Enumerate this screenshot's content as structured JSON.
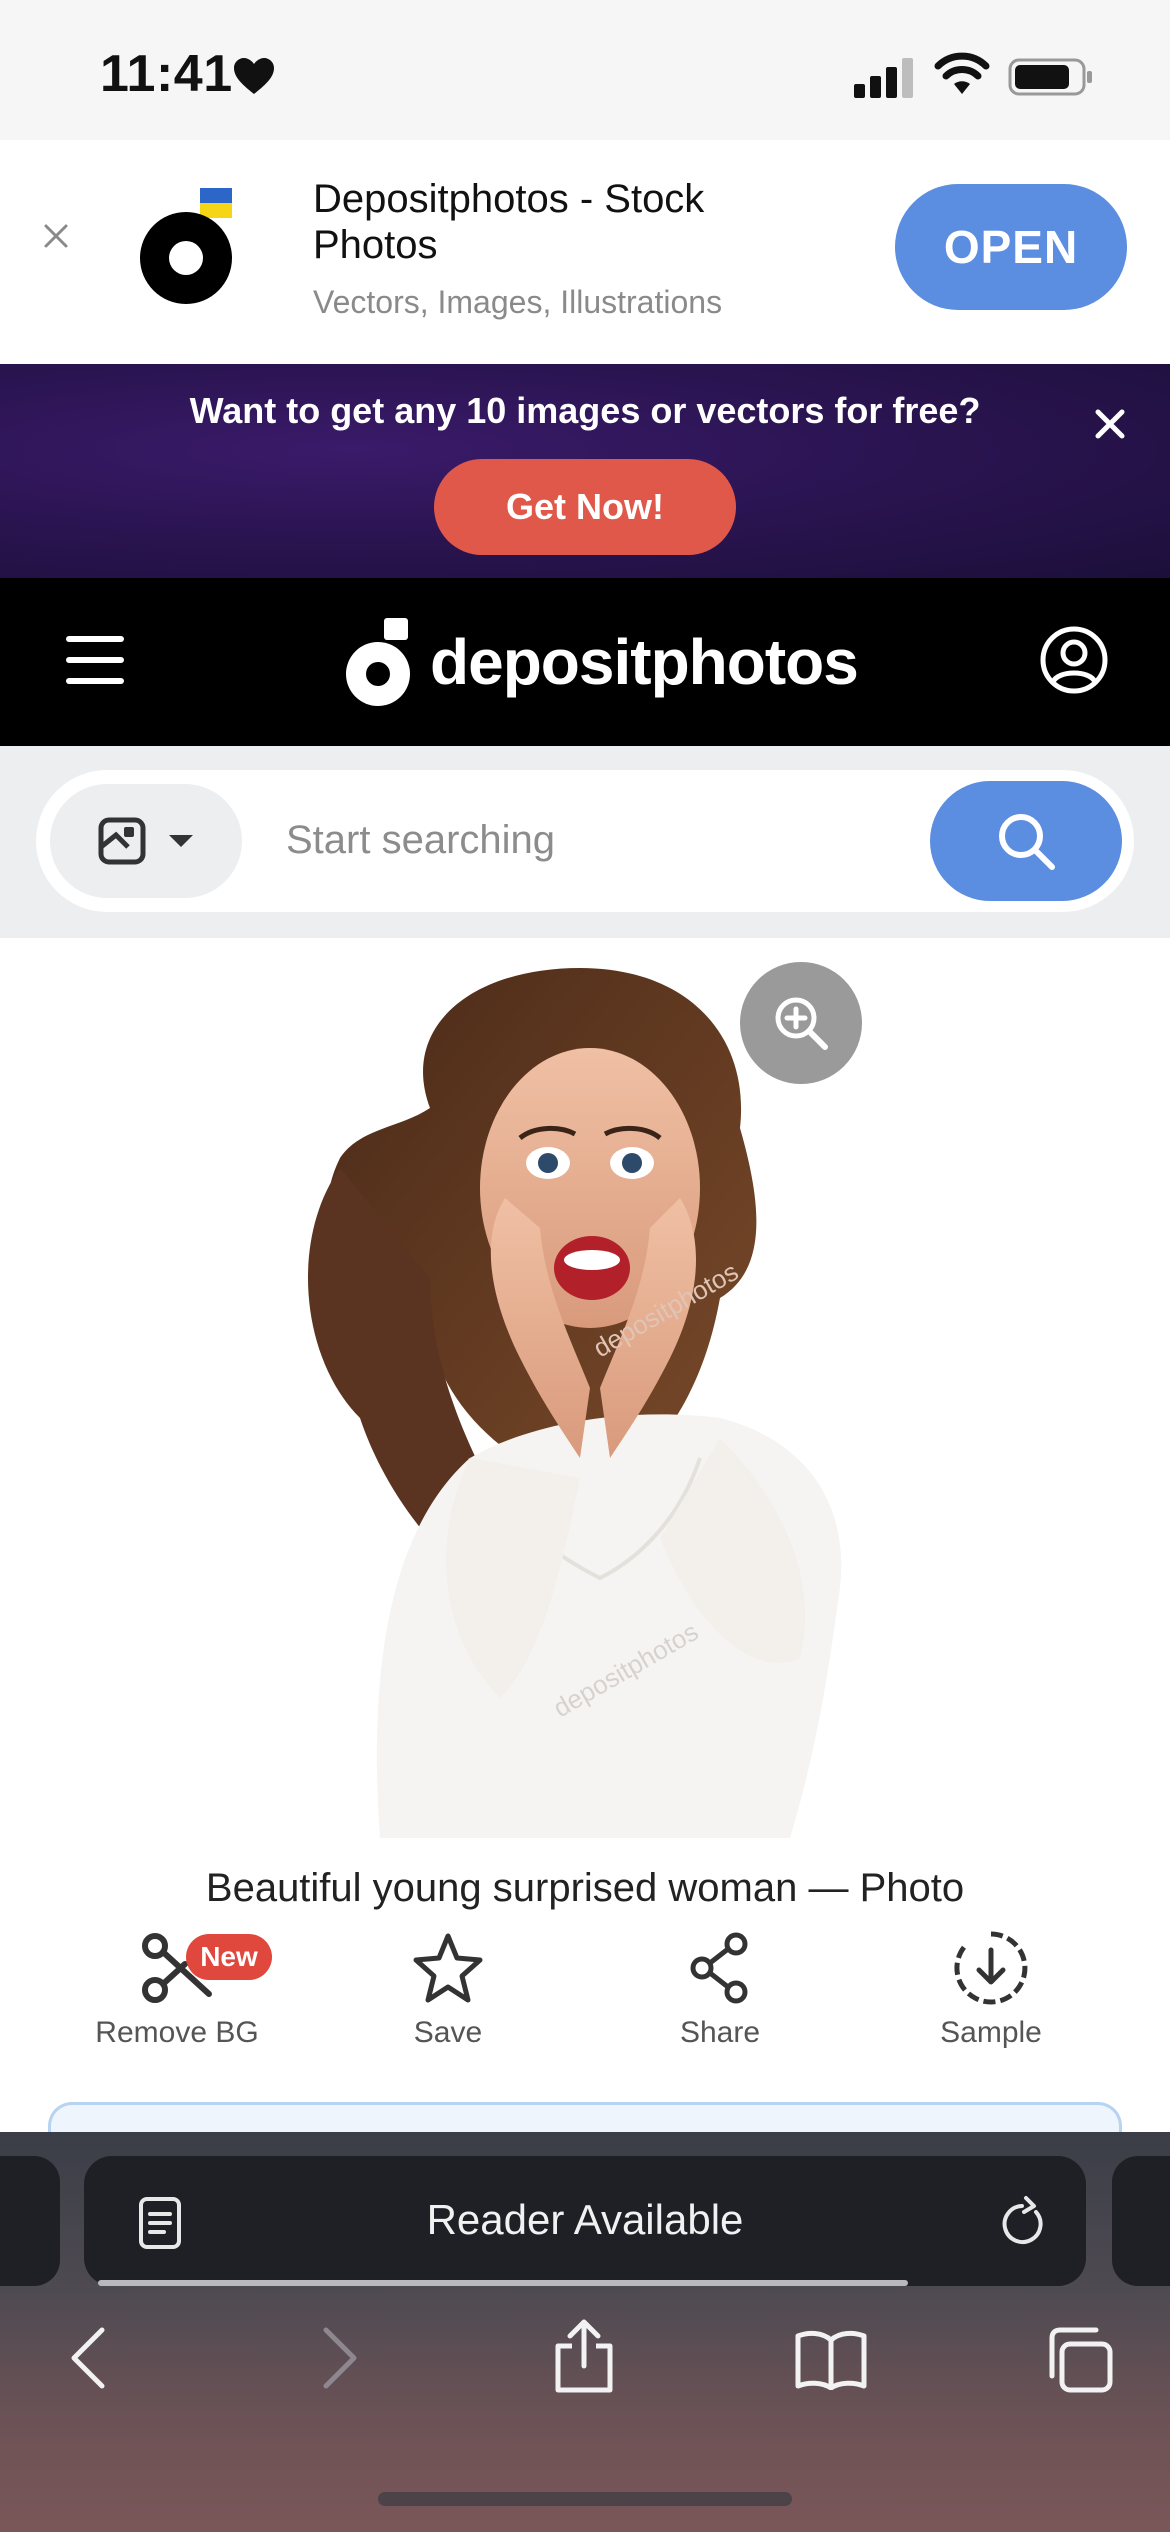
{
  "status_bar": {
    "time": "11:41"
  },
  "app_banner": {
    "name": "Depositphotos - Stock Photos",
    "subtitle": "Vectors, Images, Illustrations",
    "open_label": "OPEN"
  },
  "promo": {
    "text": "Want to get any 10 images or vectors for free?",
    "button_label": "Get Now!"
  },
  "nav": {
    "logo_text": "depositphotos"
  },
  "search": {
    "placeholder": "Start searching",
    "value": ""
  },
  "photo": {
    "title": "Beautiful young surprised woman — Photo"
  },
  "actions": [
    {
      "label": "Remove BG",
      "icon": "scissors-icon",
      "badge": "New"
    },
    {
      "label": "Save",
      "icon": "star-icon"
    },
    {
      "label": "Share",
      "icon": "share-nodes-icon"
    },
    {
      "label": "Sample",
      "icon": "download-circle-icon"
    }
  ],
  "safari": {
    "address_text": "Reader Available"
  },
  "colors": {
    "accent_blue": "#5b8de0",
    "promo_red": "#e0584a",
    "badge_red": "#e0483e",
    "promo_purple": "#2a1450"
  }
}
